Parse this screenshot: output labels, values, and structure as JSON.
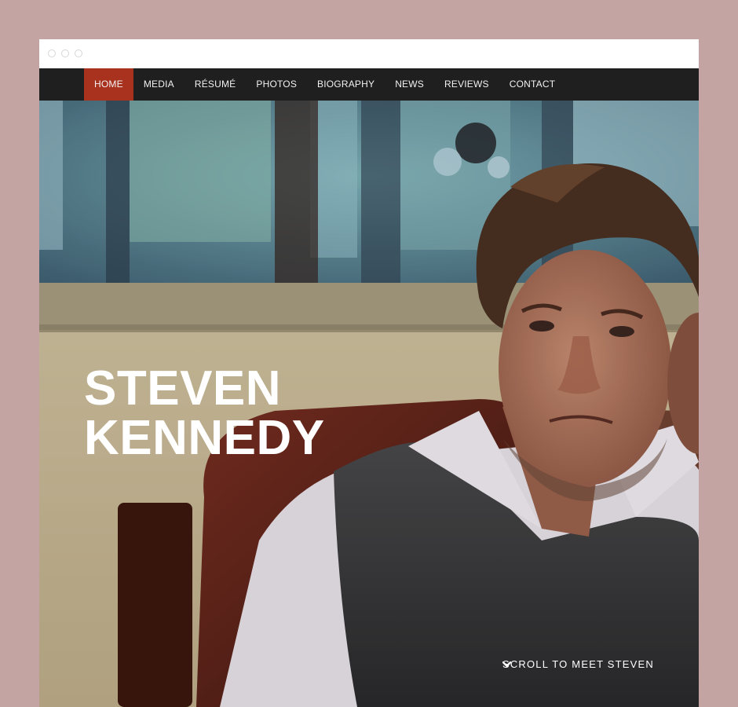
{
  "nav": {
    "items": [
      {
        "label": "HOME",
        "active": true
      },
      {
        "label": "MEDIA",
        "active": false
      },
      {
        "label": "RÉSUMÉ",
        "active": false
      },
      {
        "label": "PHOTOS",
        "active": false
      },
      {
        "label": "BIOGRAPHY",
        "active": false
      },
      {
        "label": "NEWS",
        "active": false
      },
      {
        "label": "REVIEWS",
        "active": false
      },
      {
        "label": "CONTACT",
        "active": false
      }
    ]
  },
  "hero": {
    "name_line1": "STEVEN",
    "name_line2": "KENNEDY",
    "scroll_label": "SCROLL TO MEET STEVEN",
    "scroll_icon": "chevron-down-icon"
  },
  "colors": {
    "background": "#c4a3a3",
    "nav_bg": "#1f1f1f",
    "nav_active": "#a8321e"
  }
}
